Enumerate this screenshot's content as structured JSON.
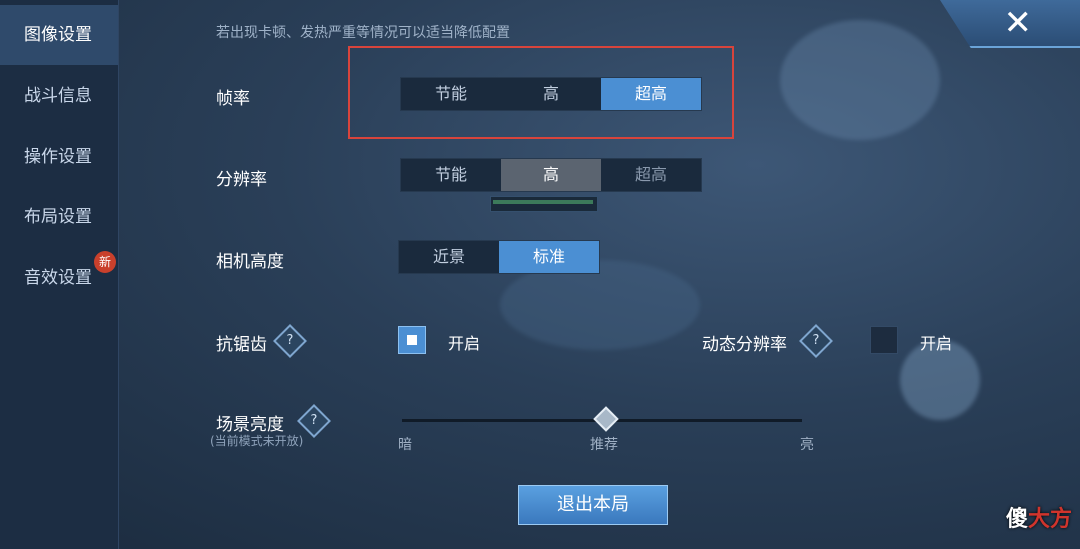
{
  "sidebar": {
    "items": [
      {
        "label": "图像设置",
        "active": true
      },
      {
        "label": "战斗信息",
        "active": false
      },
      {
        "label": "操作设置",
        "active": false
      },
      {
        "label": "布局设置",
        "active": false
      },
      {
        "label": "音效设置",
        "active": false,
        "badge": "新"
      }
    ]
  },
  "header": {
    "hint": "若出现卡顿、发热严重等情况可以适当降低配置",
    "close_icon": "close-icon"
  },
  "frame_rate": {
    "label": "帧率",
    "options": [
      "节能",
      "高",
      "超高"
    ],
    "selected": "超高"
  },
  "resolution": {
    "label": "分辨率",
    "options": [
      "节能",
      "高",
      "超高"
    ],
    "selected": "高"
  },
  "camera_height": {
    "label": "相机高度",
    "options": [
      "近景",
      "标准"
    ],
    "selected": "标准"
  },
  "anti_aliasing": {
    "label": "抗锯齿",
    "help": "?",
    "checkbox_label": "开启",
    "checked": true
  },
  "dynamic_resolution": {
    "label": "动态分辨率",
    "help": "?",
    "checkbox_label": "开启",
    "checked": false
  },
  "scene_brightness": {
    "label": "场景亮度",
    "help": "?",
    "note": "(当前模式未开放)",
    "min_label": "暗",
    "mid_label": "推荐",
    "max_label": "亮",
    "value_fraction": 0.5
  },
  "exit_button": {
    "label": "退出本局"
  },
  "watermark": {
    "text_white": "傻",
    "text_red": "大方"
  },
  "colors": {
    "accent": "#4b8fd3",
    "highlight_box": "#d8443c"
  }
}
